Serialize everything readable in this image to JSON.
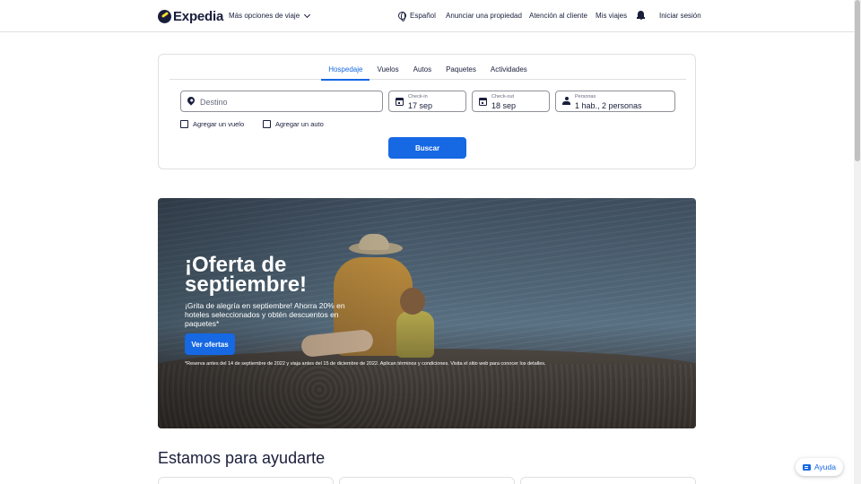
{
  "header": {
    "logo_text": "Expedia",
    "more_trip_options": "Más opciones de viaje",
    "language": "Español",
    "list_property": "Anunciar una propiedad",
    "support": "Atención al cliente",
    "my_trips": "Mis viajes",
    "sign_in": "Iniciar sesión"
  },
  "search": {
    "tabs": [
      {
        "label": "Hospedaje",
        "active": true
      },
      {
        "label": "Vuelos",
        "active": false
      },
      {
        "label": "Autos",
        "active": false
      },
      {
        "label": "Paquetes",
        "active": false
      },
      {
        "label": "Actividades",
        "active": false
      }
    ],
    "destination_placeholder": "Destino",
    "checkin_label": "Check-in",
    "checkin_value": "17 sep",
    "checkout_label": "Check-out",
    "checkout_value": "18 sep",
    "people_label": "Personas",
    "people_value": "1 hab., 2 personas",
    "add_flight": "Agregar un vuelo",
    "add_car": "Agregar un auto",
    "search_button": "Buscar"
  },
  "hero": {
    "title": "¡Oferta de septiembre!",
    "subtitle": "¡Grita de alegría en septiembre! Ahorra 20% en hoteles seleccionados y obtén descuentos en paquetes*",
    "button": "Ver ofertas",
    "disclaimer": "*Reserva antes del 14 de septiembre de 2022 y viaja antes del 15 de diciembre de 2022. Aplican términos y condiciones. Visita el sitio web para conocer los detalles."
  },
  "help": {
    "title": "Estamos para ayudarte",
    "floating_button": "Ayuda"
  },
  "colors": {
    "brand_blue": "#1668e3",
    "navy": "#191e3b",
    "logo_yellow": "#fddb32"
  }
}
